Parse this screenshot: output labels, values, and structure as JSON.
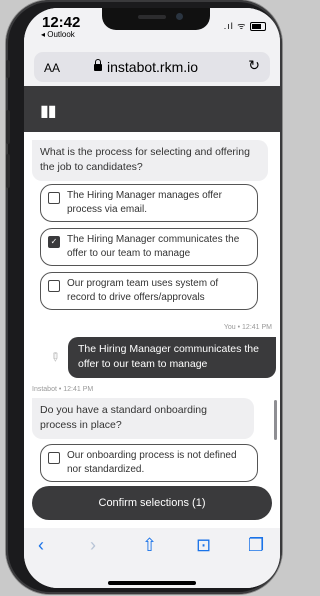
{
  "status_bar": {
    "time": "12:42",
    "back_app": "◂ Outlook",
    "signal": ".ıl ᯤ"
  },
  "browser": {
    "aa": "AA",
    "url": "instabot.rkm.io",
    "reload_icon": "↻"
  },
  "app": {
    "logo": "▮▮"
  },
  "chat": {
    "question1": "What is the process for selecting and offering the job to candidates?",
    "options1": [
      {
        "label": "The Hiring Manager manages offer process via email.",
        "checked": false
      },
      {
        "label": "The Hiring Manager communicates the offer to our team to manage",
        "checked": true
      },
      {
        "label": "Our program team uses system of record to drive offers/approvals",
        "checked": false
      }
    ],
    "user_meta": "You • 12:41 PM",
    "user_reply": "The Hiring Manager communicates the offer to our team to manage",
    "bot_meta": "Instabot • 12:41 PM",
    "question2": "Do you have a standard onboarding process in place?",
    "options2": [
      {
        "label": "Our onboarding process is not defined nor standardized.",
        "checked": false
      }
    ],
    "check_glyph": "✓"
  },
  "confirm_button": "Confirm selections (1)",
  "toolbar": {
    "back": "‹",
    "forward": "›",
    "share": "⇧",
    "bookmarks": "⊡",
    "tabs": "❐"
  }
}
